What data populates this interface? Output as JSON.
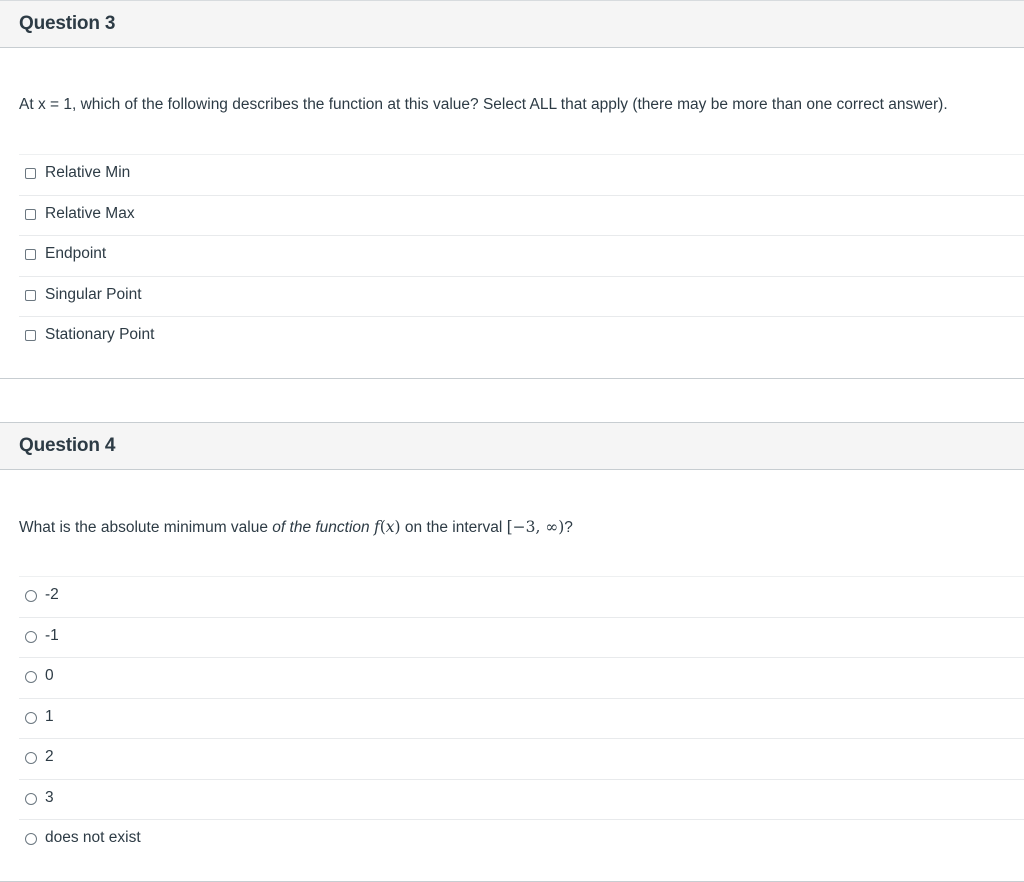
{
  "questions": [
    {
      "title": "Question 3",
      "text": "At x = 1, which of the following describes the function at this value? Select ALL that apply (there may be more than one correct answer).",
      "input_type": "checkbox",
      "answers": [
        "Relative Min",
        "Relative Max",
        "Endpoint",
        "Singular Point",
        "Stationary Point"
      ]
    },
    {
      "title": "Question 4",
      "text_parts": {
        "before": "What is the absolute minimum value ",
        "italic": "of the function",
        "func_name": "f",
        "func_open": "(",
        "func_var": "x",
        "func_close": ")",
        "middle": " on the interval ",
        "interval": "[−3, ∞)",
        "end": "?"
      },
      "input_type": "radio",
      "answers": [
        "-2",
        "-1",
        "0",
        "1",
        "2",
        "3",
        "does not exist"
      ]
    }
  ]
}
